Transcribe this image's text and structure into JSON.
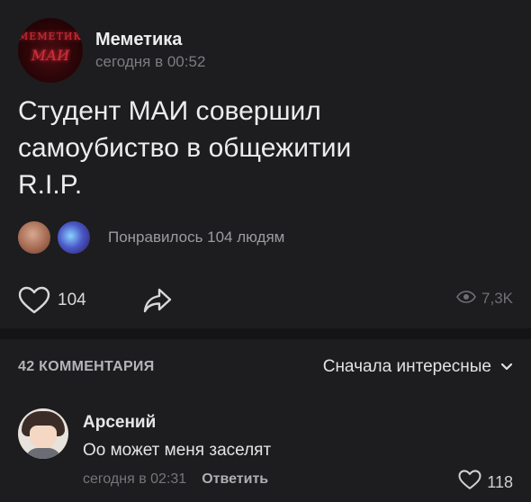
{
  "post": {
    "group_name": "Меметика",
    "avatar_text_line1": "МЕМЕТИКА",
    "avatar_text_line2": "МАИ",
    "time": "сегодня в 00:52",
    "text_lines": [
      "Студент МАИ совершил",
      "самоубиство в общежитии",
      "R.I.P."
    ],
    "liked_by_text": "Понравилось 104 людям",
    "like_count": "104",
    "views": "7,3K",
    "icons": {
      "like": "heart-icon",
      "share": "share-arrow-icon",
      "views": "eye-icon"
    }
  },
  "comments": {
    "count_label": "42 КОММЕНТАРИЯ",
    "sort_label": "Сначала интересные",
    "items": [
      {
        "author": "Арсений",
        "text": "Оо может меня заселят",
        "time": "сегодня в 02:31",
        "reply_label": "Ответить",
        "like_count": "118"
      }
    ]
  },
  "colors": {
    "background": "#1d1d1f",
    "separator": "#141416",
    "primary_text": "#ececee",
    "secondary_text": "#7c7c82"
  }
}
